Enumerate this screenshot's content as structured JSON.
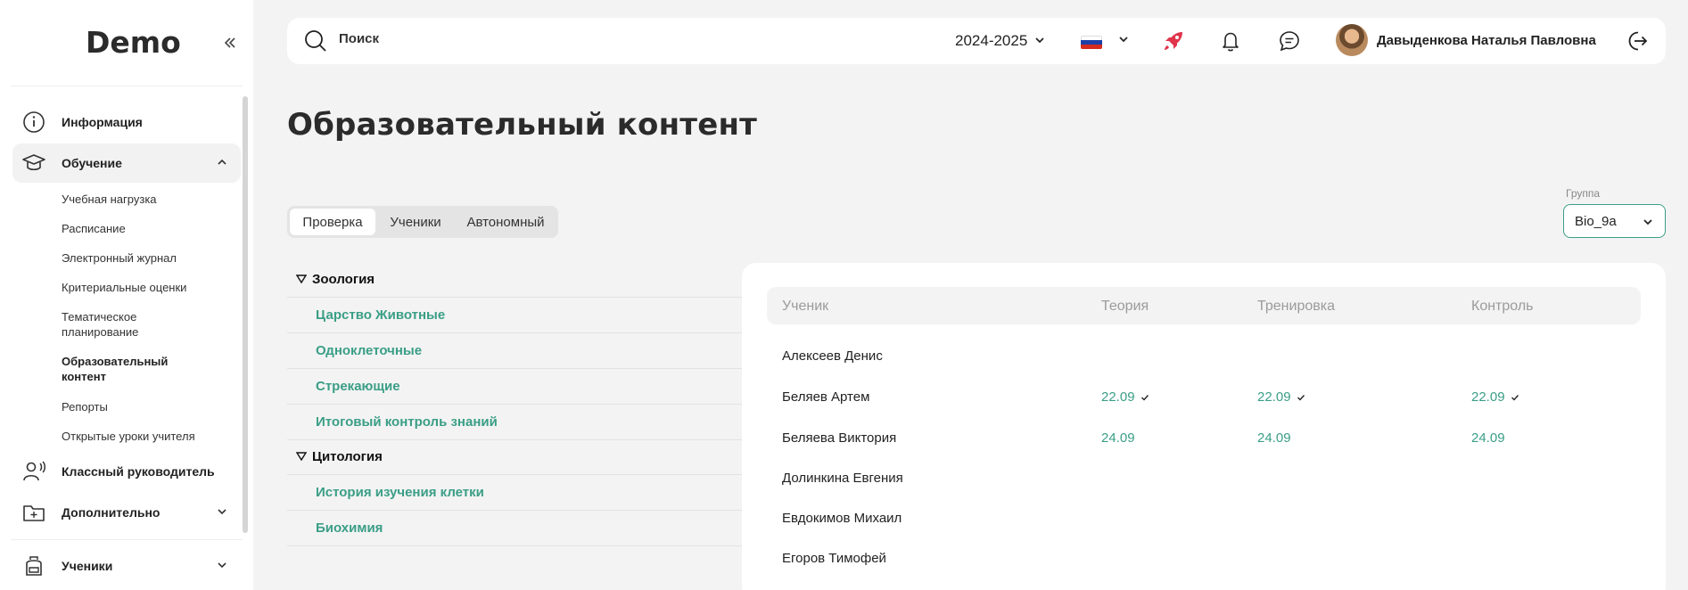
{
  "sidebar": {
    "brand": "Demo",
    "items": [
      {
        "label": "Информация"
      },
      {
        "label": "Обучение"
      },
      {
        "label": "Классный руководитель"
      },
      {
        "label": "Дополнительно"
      },
      {
        "label": "Ученики"
      }
    ],
    "subitems": [
      "Учебная нагрузка",
      "Расписание",
      "Электронный журнал",
      "Критериальные оценки",
      "Тематическое планирование",
      "Образовательный контент",
      "Репорты",
      "Открытые уроки учителя"
    ]
  },
  "header": {
    "search_placeholder": "Поиск",
    "year": "2024-2025",
    "user_name": "Давыденкова Наталья Павловна"
  },
  "colors": {
    "accent": "#3a9e86",
    "rocket": "#e0344a"
  },
  "page": {
    "title": "Образовательный контент"
  },
  "tabs": [
    "Проверка",
    "Ученики",
    "Автономный"
  ],
  "group": {
    "label": "Группа",
    "value": "Bio_9a"
  },
  "tree": [
    {
      "topic": "Зоология",
      "lessons": [
        "Царство Животные",
        "Одноклеточные",
        "Стрекающие",
        "Итоговый контроль знаний"
      ]
    },
    {
      "topic": "Цитология",
      "lessons": [
        "История изучения клетки",
        "Биохимия"
      ]
    }
  ],
  "table": {
    "headers": [
      "Ученик",
      "Теория",
      "Тренировка",
      "Контроль"
    ],
    "rows": [
      {
        "name": "Алексеев Денис",
        "theory": "",
        "training": "",
        "control": ""
      },
      {
        "name": "Беляев Артем",
        "theory": "22.09",
        "training": "22.09",
        "control": "22.09"
      },
      {
        "name": "Беляева Виктория",
        "theory": "24.09",
        "training": "24.09",
        "control": "24.09"
      },
      {
        "name": "Долинкина Евгения",
        "theory": "",
        "training": "",
        "control": ""
      },
      {
        "name": "Евдокимов Михаил",
        "theory": "",
        "training": "",
        "control": ""
      },
      {
        "name": "Егоров Тимофей",
        "theory": "",
        "training": "",
        "control": ""
      }
    ]
  }
}
